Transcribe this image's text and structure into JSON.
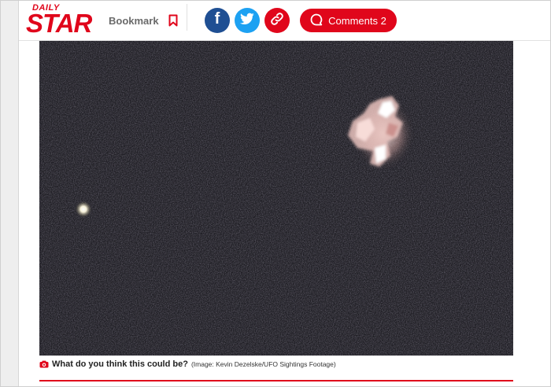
{
  "brand": {
    "logo_top": "DAILY",
    "logo_main": "STAR",
    "color": "#e0061b"
  },
  "header": {
    "bookmark_label": "Bookmark",
    "bookmark_icon": "bookmark-icon",
    "share": [
      {
        "network": "facebook",
        "icon": "facebook-icon",
        "glyph": "f",
        "color": "#1f4f93"
      },
      {
        "network": "twitter",
        "icon": "twitter-icon",
        "color": "#1da1f2"
      },
      {
        "network": "copy-link",
        "icon": "link-icon",
        "color": "#e0061b"
      }
    ],
    "comments_label": "Comments 2",
    "comments_icon": "speech-bubble-icon"
  },
  "article_image": {
    "caption": "What do you think this could be?",
    "credit": "(Image: Kevin Dezelske/UFO Sightings Footage)",
    "caption_icon": "camera-icon"
  }
}
